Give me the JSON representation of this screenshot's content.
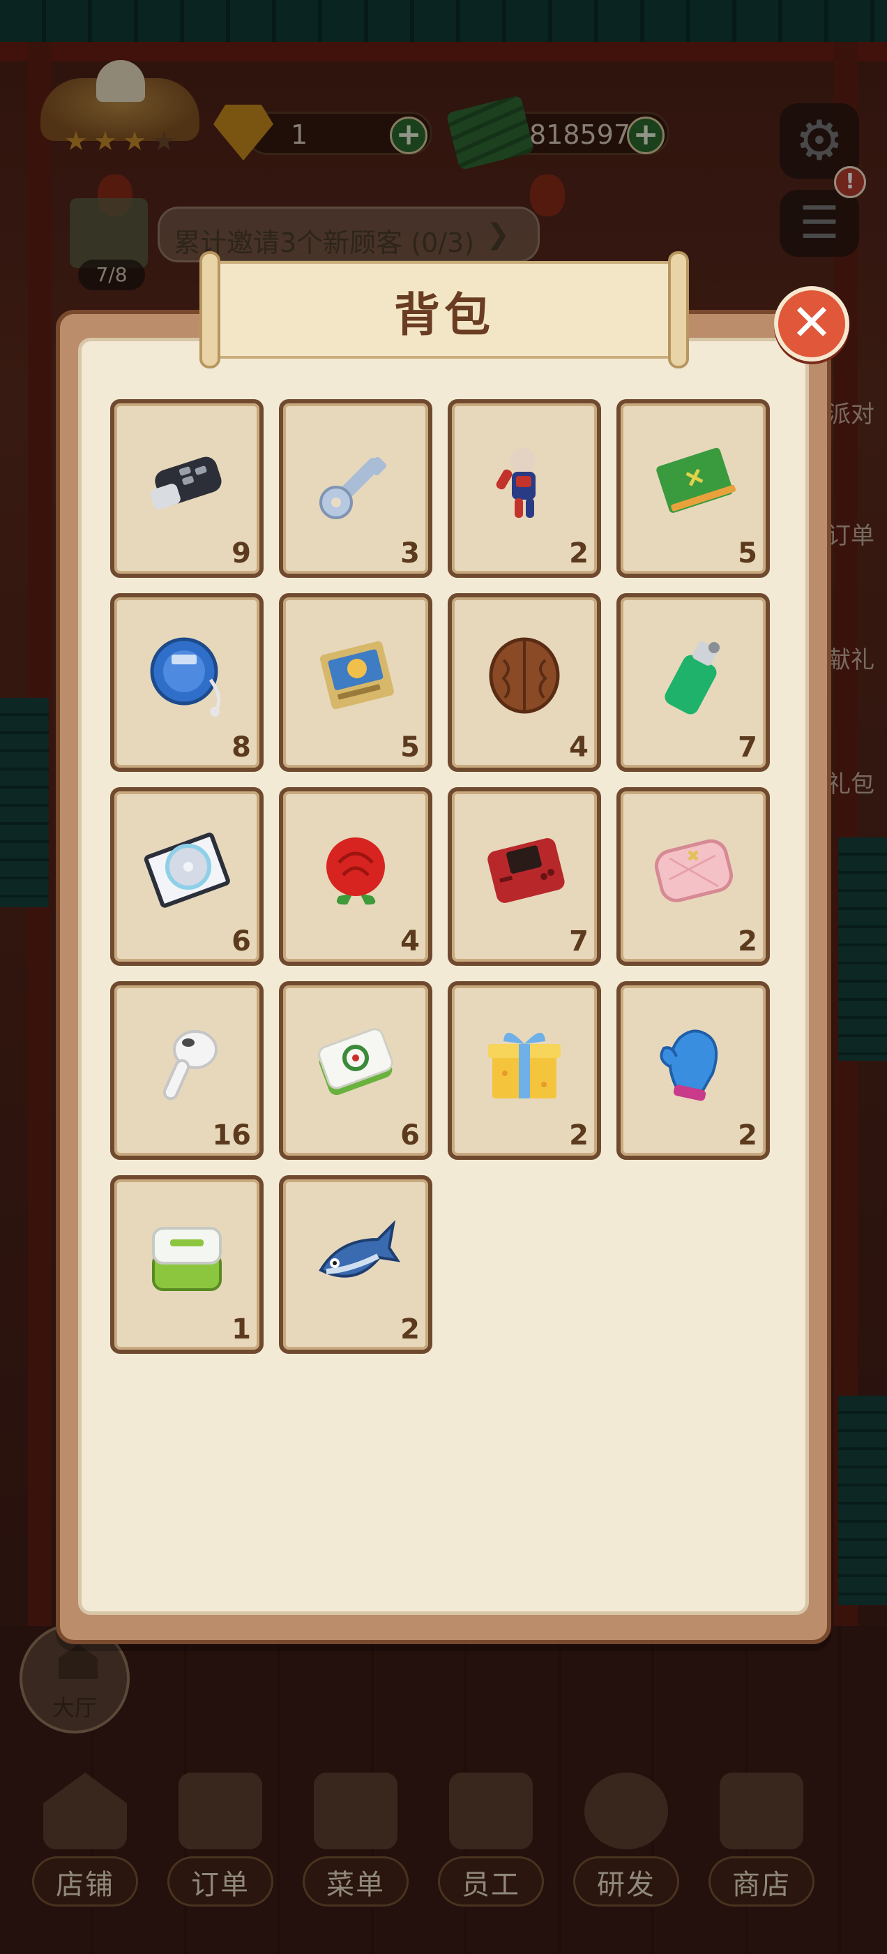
{
  "hud": {
    "gem_count": "1",
    "cash_count": "818597",
    "plus": "+",
    "badge_stars": [
      "★",
      "★",
      "★",
      "★"
    ],
    "settings_icon": "gear-icon",
    "list_icon": "list-icon",
    "alert_mark": "!"
  },
  "quest": {
    "text": "累计邀请3个新顾客 (0/3)",
    "progress": "7/8",
    "chevron": "❯"
  },
  "side_labels": [
    "派对",
    "订单",
    "献礼",
    "礼包"
  ],
  "hall_button": {
    "label": "大厅"
  },
  "modal": {
    "title": "背包",
    "close_icon": "close-icon",
    "close_glyph": "✕",
    "items": [
      {
        "name": "car-key-fob",
        "count": "9"
      },
      {
        "name": "key",
        "count": "3"
      },
      {
        "name": "hero-figurine",
        "count": "2"
      },
      {
        "name": "green-notebook",
        "count": "5"
      },
      {
        "name": "cd-player",
        "count": "8"
      },
      {
        "name": "trading-card",
        "count": "5"
      },
      {
        "name": "walnut",
        "count": "4"
      },
      {
        "name": "lighter",
        "count": "7"
      },
      {
        "name": "cd-disc",
        "count": "6"
      },
      {
        "name": "red-rose",
        "count": "4"
      },
      {
        "name": "handheld-console",
        "count": "7"
      },
      {
        "name": "pink-purse",
        "count": "2"
      },
      {
        "name": "earbud",
        "count": "16"
      },
      {
        "name": "mahjong-tile",
        "count": "6"
      },
      {
        "name": "gift-box",
        "count": "2"
      },
      {
        "name": "blue-mitten",
        "count": "2"
      },
      {
        "name": "lunch-box",
        "count": "1"
      },
      {
        "name": "fish",
        "count": "2"
      }
    ]
  },
  "bottom_nav": [
    {
      "label": "店铺",
      "icon": "shop-building-icon"
    },
    {
      "label": "订单",
      "icon": "order-scroll-icon"
    },
    {
      "label": "菜单",
      "icon": "menu-clipboard-icon"
    },
    {
      "label": "员工",
      "icon": "staff-icon"
    },
    {
      "label": "研发",
      "icon": "research-pot-icon"
    },
    {
      "label": "商店",
      "icon": "store-icon"
    }
  ]
}
